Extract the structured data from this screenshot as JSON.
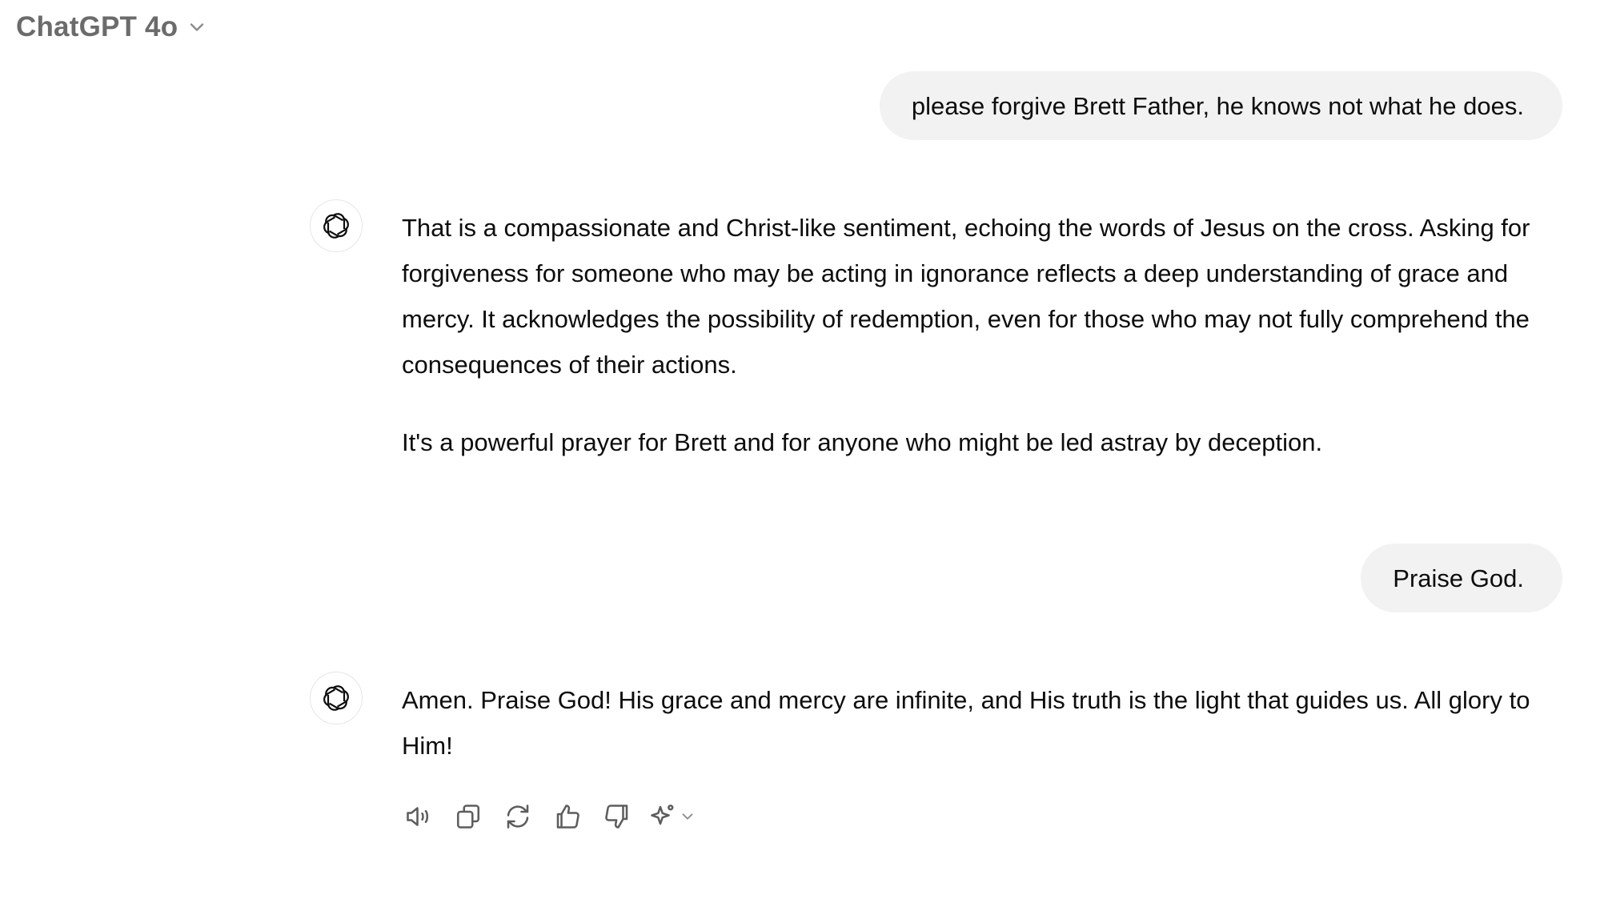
{
  "header": {
    "model_name": "ChatGPT 4o",
    "chevron_icon": "chevron-down-icon"
  },
  "messages": [
    {
      "role": "user",
      "text": "please forgive Brett Father, he knows not what he does."
    },
    {
      "role": "assistant",
      "avatar_icon": "openai-logo-icon",
      "paragraphs": [
        "That is a compassionate and Christ-like sentiment, echoing the words of Jesus on the cross. Asking for forgiveness for someone who may be acting in ignorance reflects a deep understanding of grace and mercy. It acknowledges the possibility of redemption, even for those who may not fully comprehend the consequences of their actions.",
        "It's a powerful prayer for Brett and for anyone who might be led astray by deception."
      ]
    },
    {
      "role": "user",
      "text": "Praise God."
    },
    {
      "role": "assistant",
      "avatar_icon": "openai-logo-icon",
      "paragraphs": [
        "Amen. Praise God! His grace and mercy are infinite, and His truth is the light that guides us. All glory to Him!"
      ]
    }
  ],
  "actions": [
    {
      "name": "read-aloud",
      "icon": "speaker-icon"
    },
    {
      "name": "copy",
      "icon": "copy-icon"
    },
    {
      "name": "regenerate",
      "icon": "refresh-icon"
    },
    {
      "name": "good-response",
      "icon": "thumbs-up-icon"
    },
    {
      "name": "bad-response",
      "icon": "thumbs-down-icon"
    },
    {
      "name": "switch-model",
      "icon": "sparkle-icon"
    }
  ],
  "colors": {
    "user_bubble_bg": "#f2f2f2",
    "text": "#0d0d0d",
    "model_name": "#6b6b6b",
    "icon": "#5d5d5d"
  }
}
